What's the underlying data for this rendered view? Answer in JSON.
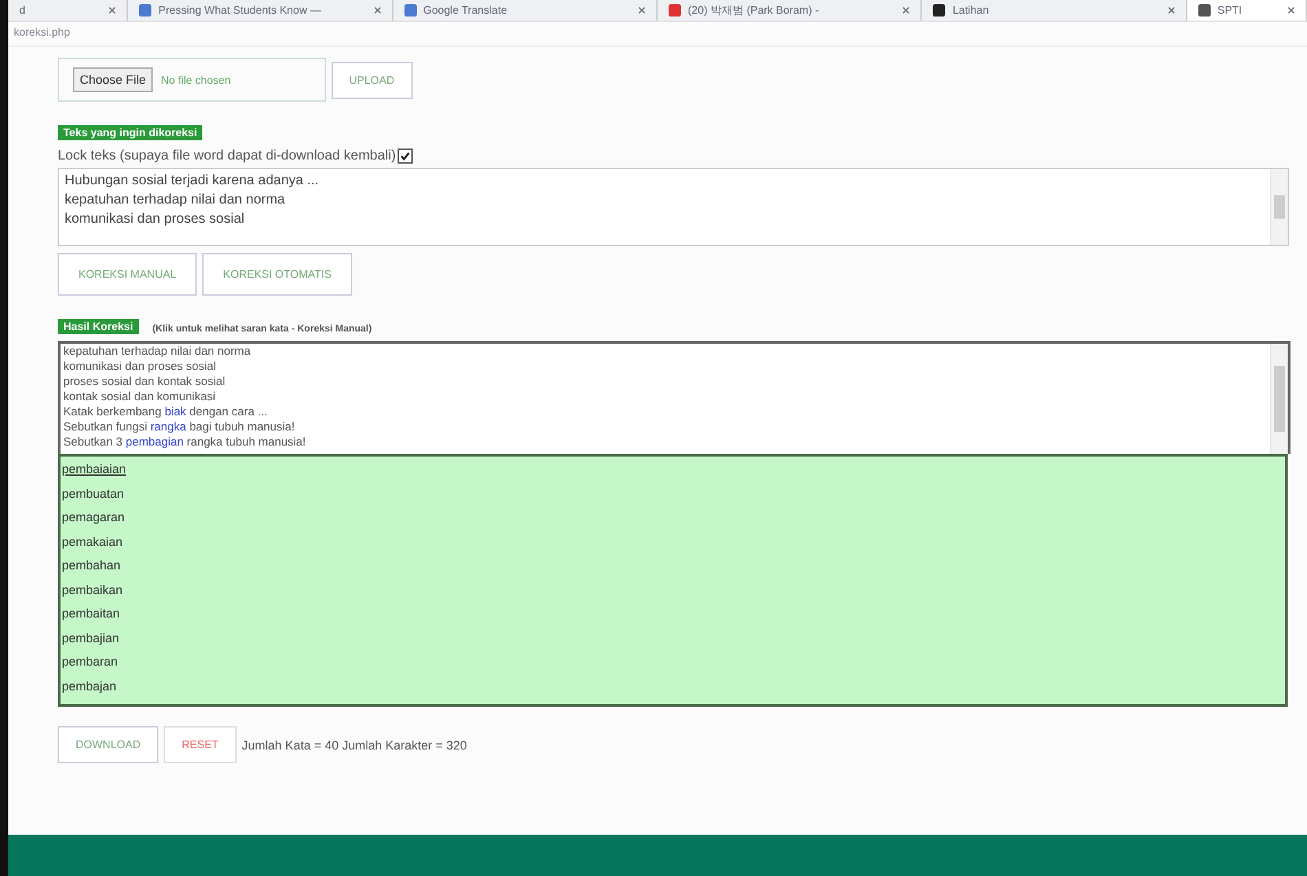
{
  "browser": {
    "tabs": [
      {
        "title": "d",
        "selected": false
      },
      {
        "title": "Pressing What Students Know —",
        "selected": false
      },
      {
        "title": "Google Translate",
        "selected": false
      },
      {
        "title": "(20) 박재범 (Park Boram) - ",
        "selected": false
      },
      {
        "title": "Latihan",
        "selected": false
      },
      {
        "title": "SPTI",
        "selected": true
      }
    ],
    "address": "koreksi.php"
  },
  "upload": {
    "choose_label": "Choose File",
    "file_status": "No file chosen",
    "upload_button": "UPLOAD"
  },
  "input_section": {
    "badge": "Teks yang ingin dikoreksi",
    "lock_label": "Lock teks (supaya file word dapat di-download kembali)",
    "lock_checked": true,
    "lines": [
      "Hubungan sosial terjadi karena adanya ...",
      "kepatuhan terhadap nilai dan norma",
      "komunikasi dan proses sosial"
    ],
    "buttons": [
      "KOREKSI MANUAL",
      "KOREKSI OTOMATIS"
    ]
  },
  "result_section": {
    "badge": "Hasil Koreksi",
    "hint": "(Klik untuk melihat saran kata - Koreksi Manual)",
    "lines": [
      [
        {
          "text": "kepatuhan terhadap nilai dan norma",
          "flagged": false
        }
      ],
      [
        {
          "text": "komunikasi dan proses sosial",
          "flagged": false
        }
      ],
      [
        {
          "text": "proses sosial dan kontak sosial",
          "flagged": false
        }
      ],
      [
        {
          "text": "kontak sosial dan komunikasi",
          "flagged": false
        }
      ],
      [
        {
          "text": "Katak berkembang ",
          "flagged": false
        },
        {
          "text": "biak",
          "flagged": true
        },
        {
          "text": " dengan cara ...",
          "flagged": false
        }
      ],
      [
        {
          "text": "Sebutkan fungsi ",
          "flagged": false
        },
        {
          "text": "rangka",
          "flagged": true
        },
        {
          "text": " bagi tubuh manusia!",
          "flagged": false
        }
      ],
      [
        {
          "text": "Sebutkan 3 ",
          "flagged": false
        },
        {
          "text": "pembagian",
          "flagged": true
        },
        {
          "text": " rangka tubuh manusia!",
          "flagged": false
        }
      ]
    ],
    "suggestions": [
      {
        "text": "pembaiaian",
        "selected": true
      },
      {
        "text": "pembuatan",
        "selected": false
      },
      {
        "text": "pemagaran",
        "selected": false
      },
      {
        "text": "pemakaian",
        "selected": false
      },
      {
        "text": "pembahan",
        "selected": false
      },
      {
        "text": "pembaikan",
        "selected": false
      },
      {
        "text": "pembaitan",
        "selected": false
      },
      {
        "text": "pembajian",
        "selected": false
      },
      {
        "text": "pembaran",
        "selected": false
      },
      {
        "text": "pembajan",
        "selected": false
      }
    ]
  },
  "footer_bar": {
    "download_button": "DOWNLOAD",
    "reset_button": "RESET",
    "stats": "Jumlah Kata = 40 Jumlah Karakter = 320"
  }
}
